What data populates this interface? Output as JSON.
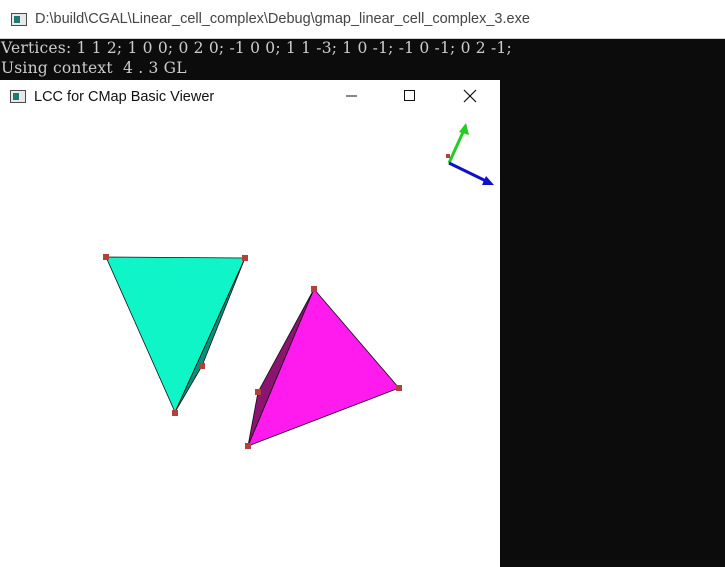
{
  "console": {
    "title": "D:\\build\\CGAL\\Linear_cell_complex\\Debug\\gmap_linear_cell_complex_3.exe",
    "lines": [
      "Vertices: 1 1 2; 1 0 0; 0 2 0; -1 0 0; 1 1 -3; 1 0 -1; -1 0 -1; 0 2 -1;",
      "Using context  4 . 3 GL"
    ]
  },
  "viewer": {
    "title": "LCC for CMap Basic Viewer",
    "icons": {
      "app": "console-window-icon",
      "minimize": "minimize-icon",
      "maximize": "maximize-icon",
      "close": "close-icon"
    }
  },
  "colors": {
    "console_bg": "#0c0c0c",
    "console_text": "#cccccc",
    "cyan_face": "#0ff5c8",
    "magenta_face": "#ff1aee",
    "magenta_side": "#8a1470",
    "vertex_marker": "#b3403a",
    "axis_green": "#22cc22",
    "axis_blue": "#1010c8"
  }
}
